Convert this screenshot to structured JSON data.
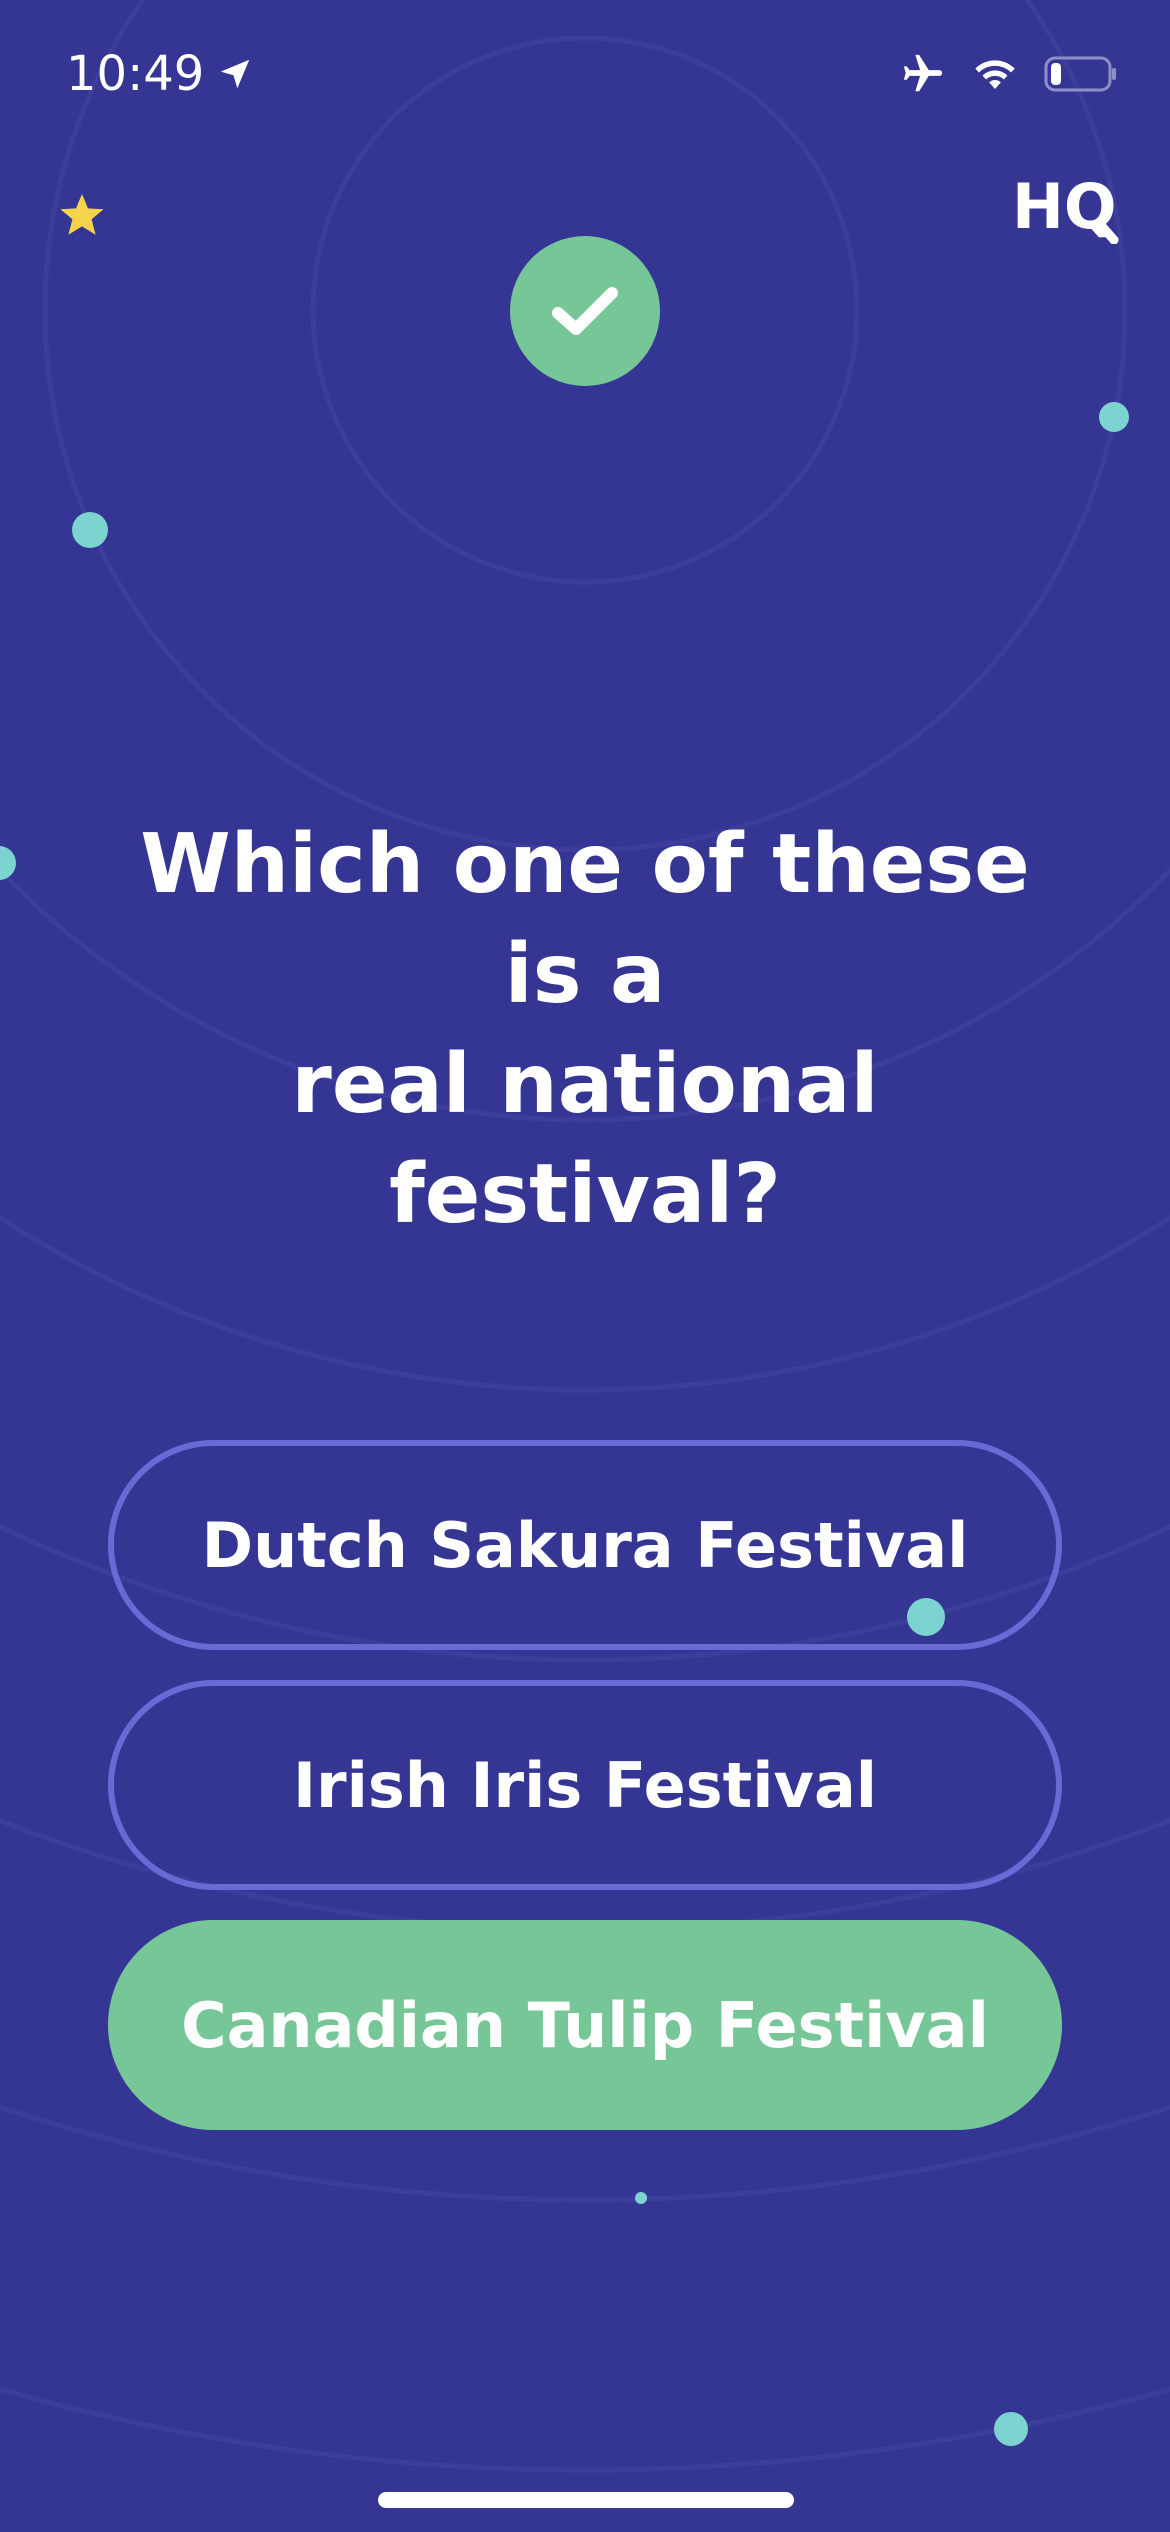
{
  "status_bar": {
    "time": "10:49",
    "location_icon": "location-arrow-icon",
    "airplane_icon": "airplane-icon",
    "wifi_icon": "wifi-icon",
    "battery_icon": "battery-low-icon"
  },
  "header": {
    "logo_text": "HQ",
    "star_icon": "star-icon"
  },
  "result": {
    "icon": "checkmark-icon",
    "color": "#76c698"
  },
  "question": {
    "line1": "Which one of these is a",
    "line2": "real national festival?"
  },
  "answers": [
    {
      "label": "Dutch Sakura Festival",
      "state": "unselected"
    },
    {
      "label": "Irish Iris Festival",
      "state": "unselected"
    },
    {
      "label": "Canadian Tulip Festival",
      "state": "correct"
    }
  ],
  "colors": {
    "background": "#353593",
    "correct": "#76c698",
    "outline": "#6a6ad6",
    "dot": "#7dd3d0",
    "star": "#f5d34a"
  }
}
